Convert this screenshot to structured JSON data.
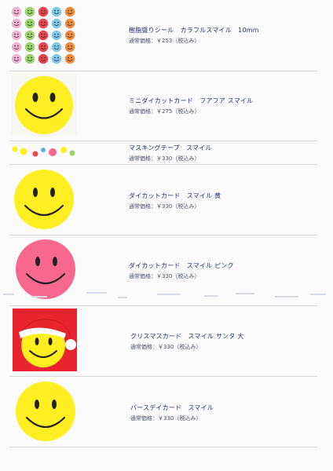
{
  "products": [
    {
      "name": "樹脂盛りシール　カラフルスマイル　10mm",
      "price": "通常価格：￥253（税込み）",
      "image": "colorful-smiley-stickers"
    },
    {
      "name": "ミニダイカットカード　フアフア スマイル",
      "price": "通常価格：￥275（税込み）",
      "image": "yellow-smiley-mini-card"
    },
    {
      "name": "マスキングテープ　スマイル",
      "price": "通常価格：￥330（税込み）",
      "image": "smiley-masking-tape"
    },
    {
      "name": "ダイカットカード　スマイル 黄",
      "price": "通常価格：￥330（税込み）",
      "image": "yellow-smiley-card"
    },
    {
      "name": "ダイカットカード　スマイル ピンク",
      "price": "通常価格：￥330（税込み）",
      "image": "pink-smiley-card"
    },
    {
      "name": "クリスマスカード　スマイル サンタ 大",
      "price": "通常価格：￥330（税込み）",
      "image": "santa-smiley-card"
    },
    {
      "name": "バースデイカード　スマイル",
      "price": "通常価格：￥330（税込み）",
      "image": "birthday-smiley-card"
    }
  ],
  "colors": {
    "yellow": "#ffee22",
    "pink": "#f7678e",
    "red": "#e8242c",
    "text": "#1e2f73",
    "sticker_colors": [
      "#f2b3d0",
      "#7ec8e8",
      "#f5e14a",
      "#9ad46a",
      "#f08a3c",
      "#b48ad8",
      "#e8454c",
      "#5ab0e6"
    ]
  }
}
